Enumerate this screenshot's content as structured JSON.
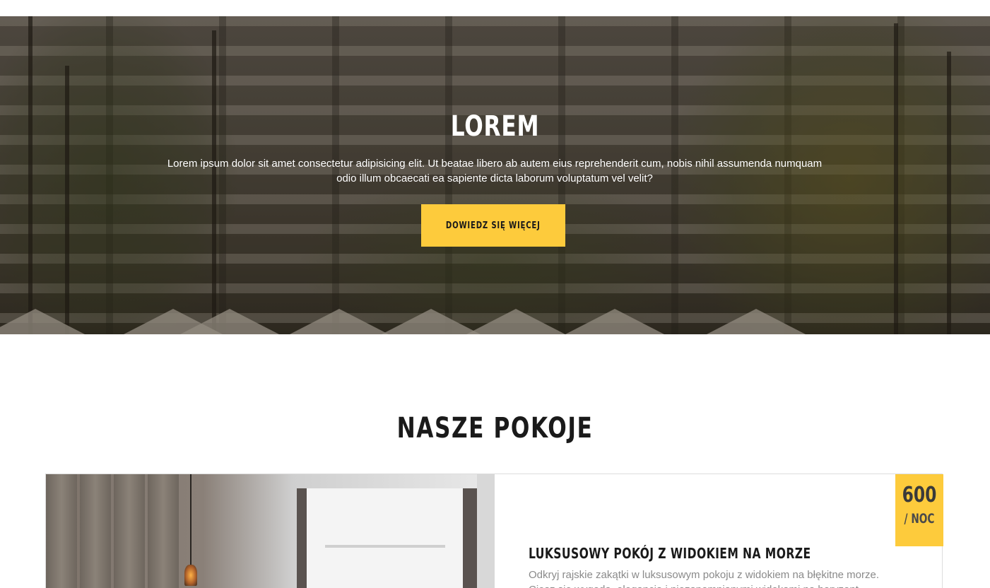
{
  "hero": {
    "title": "LOREM",
    "text": "Lorem ipsum dolor sit amet consectetur adipisicing elit. Ut beatae libero ab autem eius reprehenderit cum, nobis nihil assumenda numquam odio illum obcaecati ea sapiente dicta laborum voluptatum vel velit?",
    "button_label": "DOWIEDZ SIĘ WIĘCEJ"
  },
  "rooms": {
    "section_title": "NASZE POKOJE",
    "items": [
      {
        "name": "LUKSUSOWY POKÓJ Z WIDOKIEM NA MORZE",
        "description": "Odkryj rajskie zakątki w luksusowym pokoju z widokiem na błękitne morze. Ciesz się wygodą, elegancją i niezapomnianymi widokami na horyzont.",
        "price": "600",
        "price_unit": "/ NOC"
      }
    ]
  },
  "colors": {
    "accent": "#fdcb3c",
    "heading": "#1a1a1a",
    "muted_text": "#8a8a8a"
  }
}
